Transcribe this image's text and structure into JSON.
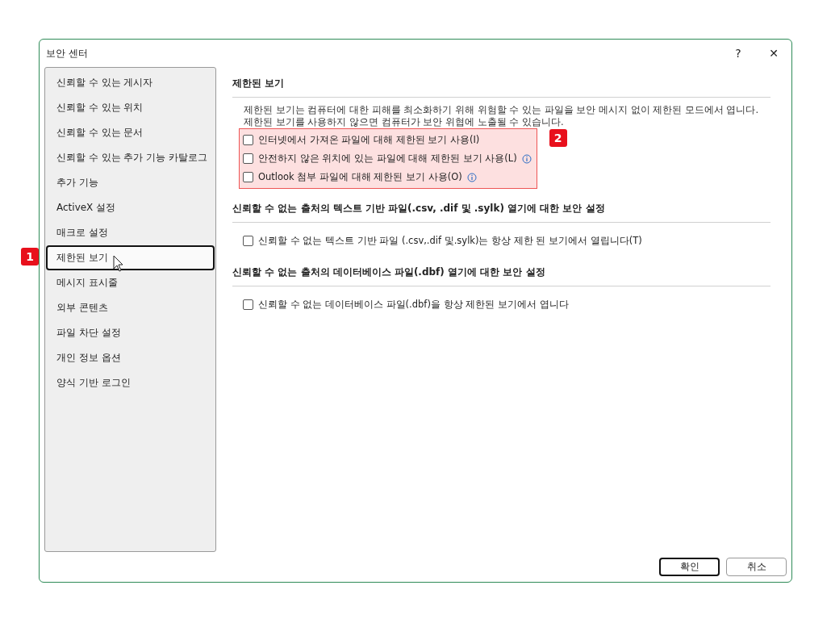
{
  "window": {
    "title": "보안 센터",
    "help": "?",
    "close": "✕"
  },
  "sidebar": {
    "items": [
      {
        "label": "신뢰할 수 있는 게시자",
        "selected": false
      },
      {
        "label": "신뢰할 수 있는 위치",
        "selected": false
      },
      {
        "label": "신뢰할 수 있는 문서",
        "selected": false
      },
      {
        "label": "신뢰할 수 있는 추가 기능 카탈로그",
        "selected": false
      },
      {
        "label": "추가 기능",
        "selected": false
      },
      {
        "label": "ActiveX 설정",
        "selected": false
      },
      {
        "label": "매크로 설정",
        "selected": false
      },
      {
        "label": "제한된 보기",
        "selected": true,
        "badge": "1"
      },
      {
        "label": "메시지 표시줄",
        "selected": false
      },
      {
        "label": "외부 콘텐츠",
        "selected": false
      },
      {
        "label": "파일 차단 설정",
        "selected": false
      },
      {
        "label": "개인 정보 옵션",
        "selected": false
      },
      {
        "label": "양식 기반 로그인",
        "selected": false
      }
    ]
  },
  "sections": [
    {
      "title": "제한된 보기",
      "description": "제한된 보기는 컴퓨터에 대한 피해를 최소화하기 위해 위험할 수 있는 파일을 보안 메시지 없이 제한된 모드에서 엽니다. 제한된 보기를 사용하지 않으면 컴퓨터가 보안 위협에 노출될 수 있습니다.",
      "highlighted": true,
      "badge": "2",
      "options": [
        {
          "label": "인터넷에서 가져온 파일에 대해 제한된 보기 사용(I)",
          "checked": false,
          "info": false
        },
        {
          "label": "안전하지 않은 위치에 있는 파일에 대해 제한된 보기 사용(L)",
          "checked": false,
          "info": true
        },
        {
          "label": "Outlook 첨부 파일에 대해 제한된 보기 사용(O)",
          "checked": false,
          "info": true
        }
      ]
    },
    {
      "title": "신뢰할 수 없는 출처의 텍스트 기반 파일(.csv, .dif 및 .sylk) 열기에 대한 보안 설정",
      "highlighted": false,
      "options": [
        {
          "label": "신뢰할 수 없는 텍스트 기반 파일 (.csv,.dif 및.sylk)는 항상 제한 된 보기에서 열립니다(T)",
          "checked": false,
          "info": false
        }
      ]
    },
    {
      "title": "신뢰할 수 없는 출처의 데이터베이스 파일(.dbf) 열기에 대한 보안 설정",
      "highlighted": false,
      "options": [
        {
          "label": "신뢰할 수 없는 데이터베이스 파일(.dbf)을 항상 제한된 보기에서 엽니다",
          "checked": false,
          "info": false
        }
      ]
    }
  ],
  "buttons": [
    {
      "label": "확인",
      "default": true
    },
    {
      "label": "취소",
      "default": false
    }
  ]
}
